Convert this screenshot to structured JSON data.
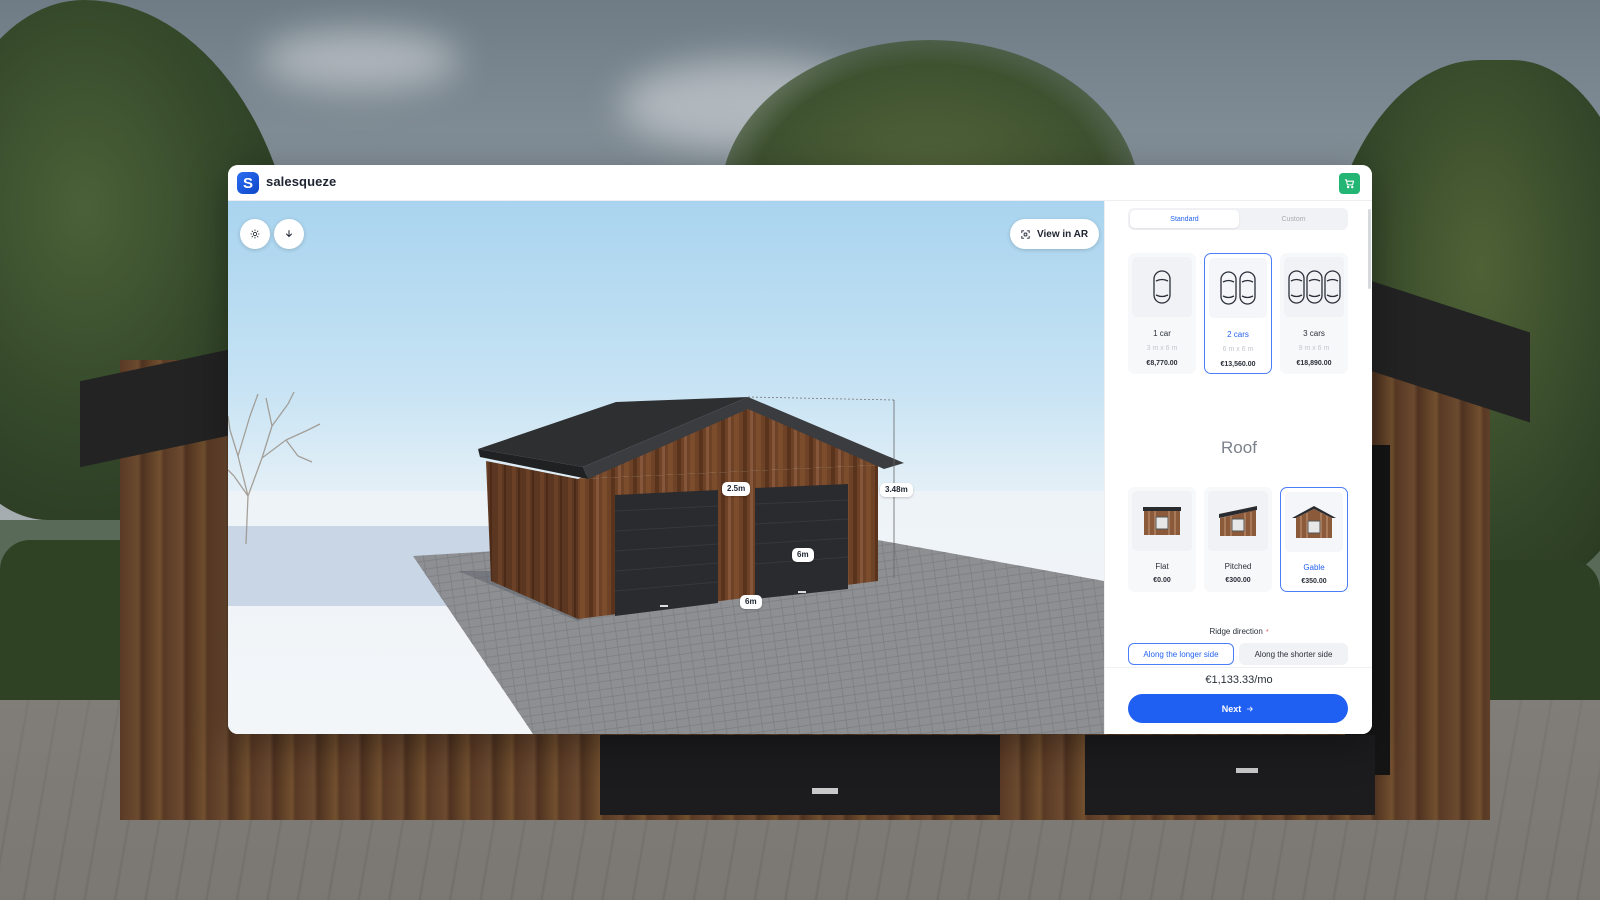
{
  "app": {
    "brand": "salesqueze",
    "logo_letter": "S"
  },
  "viewport": {
    "view_ar_label": "View in AR",
    "dimensions": {
      "door_height": "2.5m",
      "total_height": "3.48m",
      "depth": "6m",
      "width": "6m"
    }
  },
  "panel": {
    "tabs": [
      {
        "label": "Standard",
        "active": true
      },
      {
        "label": "Custom",
        "active": false
      }
    ],
    "size_options": [
      {
        "label": "1 car",
        "size": "3 m x 6 m",
        "price": "€8,770.00",
        "selected": false
      },
      {
        "label": "2 cars",
        "size": "6 m x 6 m",
        "price": "€13,560.00",
        "selected": true
      },
      {
        "label": "3 cars",
        "size": "9 m x 6 m",
        "price": "€18,890.00",
        "selected": false
      }
    ],
    "roof": {
      "title": "Roof",
      "options": [
        {
          "label": "Flat",
          "price": "€0.00",
          "selected": false
        },
        {
          "label": "Pitched",
          "price": "€300.00",
          "selected": false
        },
        {
          "label": "Gable",
          "price": "€350.00",
          "selected": true
        }
      ]
    },
    "ridge": {
      "label": "Ridge direction",
      "required_mark": "*",
      "options": [
        {
          "label": "Along the longer side",
          "selected": true
        },
        {
          "label": "Along the shorter side",
          "selected": false
        }
      ]
    },
    "footer": {
      "monthly_price": "€1,133.33/mo",
      "next_label": "Next"
    }
  },
  "icons": {
    "sun": "sun-icon",
    "download": "download-icon",
    "ar": "ar-scan-icon",
    "cart": "cart-icon",
    "arrow": "arrow-right-icon"
  },
  "colors": {
    "accent": "#1f5ff2",
    "selected_border": "#4b7df6",
    "cart": "#22b573"
  }
}
